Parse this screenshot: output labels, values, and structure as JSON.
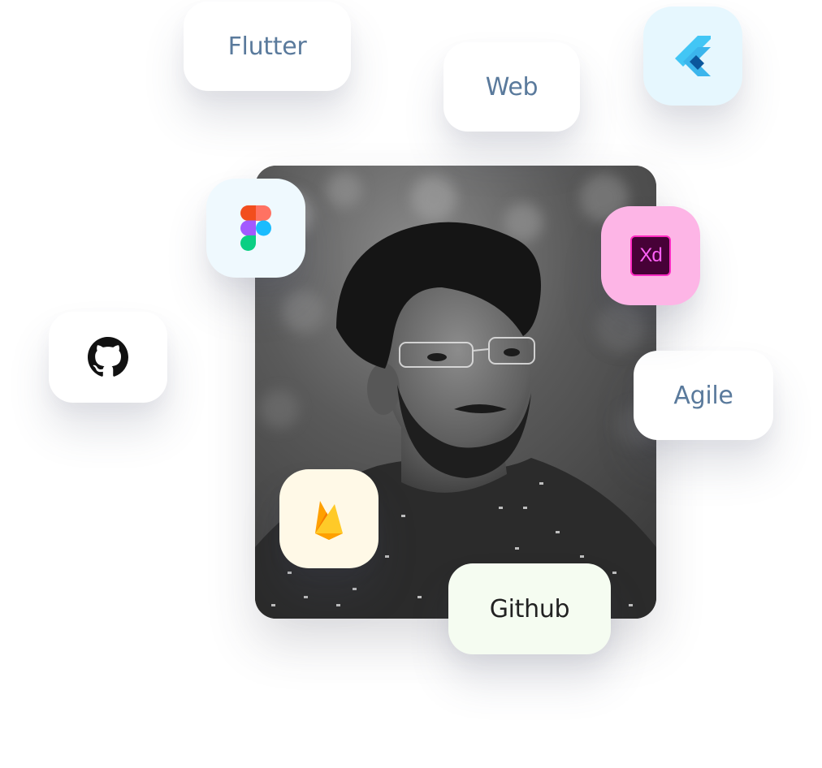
{
  "skills": {
    "flutter": "Flutter",
    "web": "Web",
    "agile": "Agile",
    "github": "Github"
  },
  "icons": {
    "flutter": "flutter-logo-icon",
    "figma": "figma-logo-icon",
    "xd": "adobe-xd-logo-icon",
    "xd_text": "Xd",
    "github": "github-octocat-icon",
    "firebase": "firebase-flame-icon"
  },
  "profile": {
    "photo": "profile-photo"
  },
  "colors": {
    "flutter_bg": "#e6f7fe",
    "figma_bg": "#eff9fe",
    "xd_bg": "#fdb5e6",
    "firebase_bg": "#fff9e7",
    "github_chip_bg": "#f5fcf1",
    "chip_text": "#5a7a9c"
  }
}
